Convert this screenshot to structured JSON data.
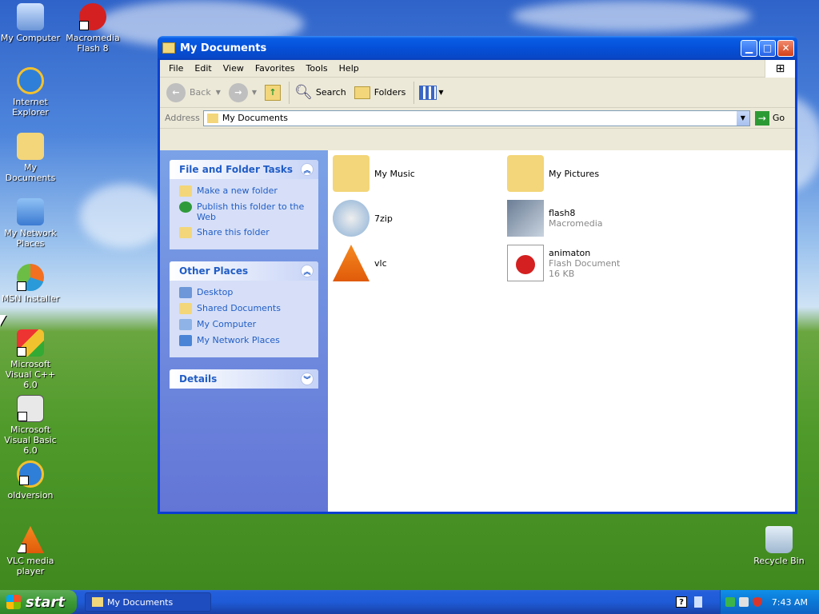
{
  "desktop": {
    "icons": [
      {
        "label": "My Computer",
        "icon": "my-computer-icon"
      },
      {
        "label": "Macromedia Flash 8",
        "icon": "flash-icon"
      },
      {
        "label": "Internet Explorer",
        "icon": "internet-explorer-icon"
      },
      {
        "label": "My Documents",
        "icon": "folder-icon"
      },
      {
        "label": "My Network Places",
        "icon": "network-icon"
      },
      {
        "label": "MSN Installer",
        "icon": "msn-icon"
      },
      {
        "label": "Microsoft Visual C++ 6.0",
        "icon": "visual-cpp-icon"
      },
      {
        "label": "Microsoft Visual Basic 6.0",
        "icon": "visual-basic-icon"
      },
      {
        "label": "oldversion",
        "icon": "internet-explorer-icon"
      },
      {
        "label": "VLC media player",
        "icon": "vlc-icon"
      },
      {
        "label": "Recycle Bin",
        "icon": "recycle-bin-icon"
      }
    ]
  },
  "window": {
    "title": "My Documents",
    "menu": [
      "File",
      "Edit",
      "View",
      "Favorites",
      "Tools",
      "Help"
    ],
    "toolbar": {
      "back": "Back",
      "search": "Search",
      "folders": "Folders"
    },
    "address": {
      "label": "Address",
      "value": "My Documents",
      "go": "Go"
    },
    "tasks": {
      "title": "File and Folder Tasks",
      "items": [
        "Make a new folder",
        "Publish this folder to the Web",
        "Share this folder"
      ]
    },
    "other_places": {
      "title": "Other Places",
      "items": [
        "Desktop",
        "Shared Documents",
        "My Computer",
        "My Network Places"
      ]
    },
    "details": {
      "title": "Details"
    },
    "files": [
      {
        "name": "My Music",
        "sub1": "",
        "sub2": ""
      },
      {
        "name": "My Pictures",
        "sub1": "",
        "sub2": ""
      },
      {
        "name": "7zip",
        "sub1": "",
        "sub2": ""
      },
      {
        "name": "flash8",
        "sub1": "Macromedia",
        "sub2": ""
      },
      {
        "name": "vlc",
        "sub1": "",
        "sub2": ""
      },
      {
        "name": "animaton",
        "sub1": "Flash Document",
        "sub2": "16 KB"
      }
    ]
  },
  "taskbar": {
    "start": "start",
    "task": "My Documents",
    "clock": "7:43 AM"
  }
}
